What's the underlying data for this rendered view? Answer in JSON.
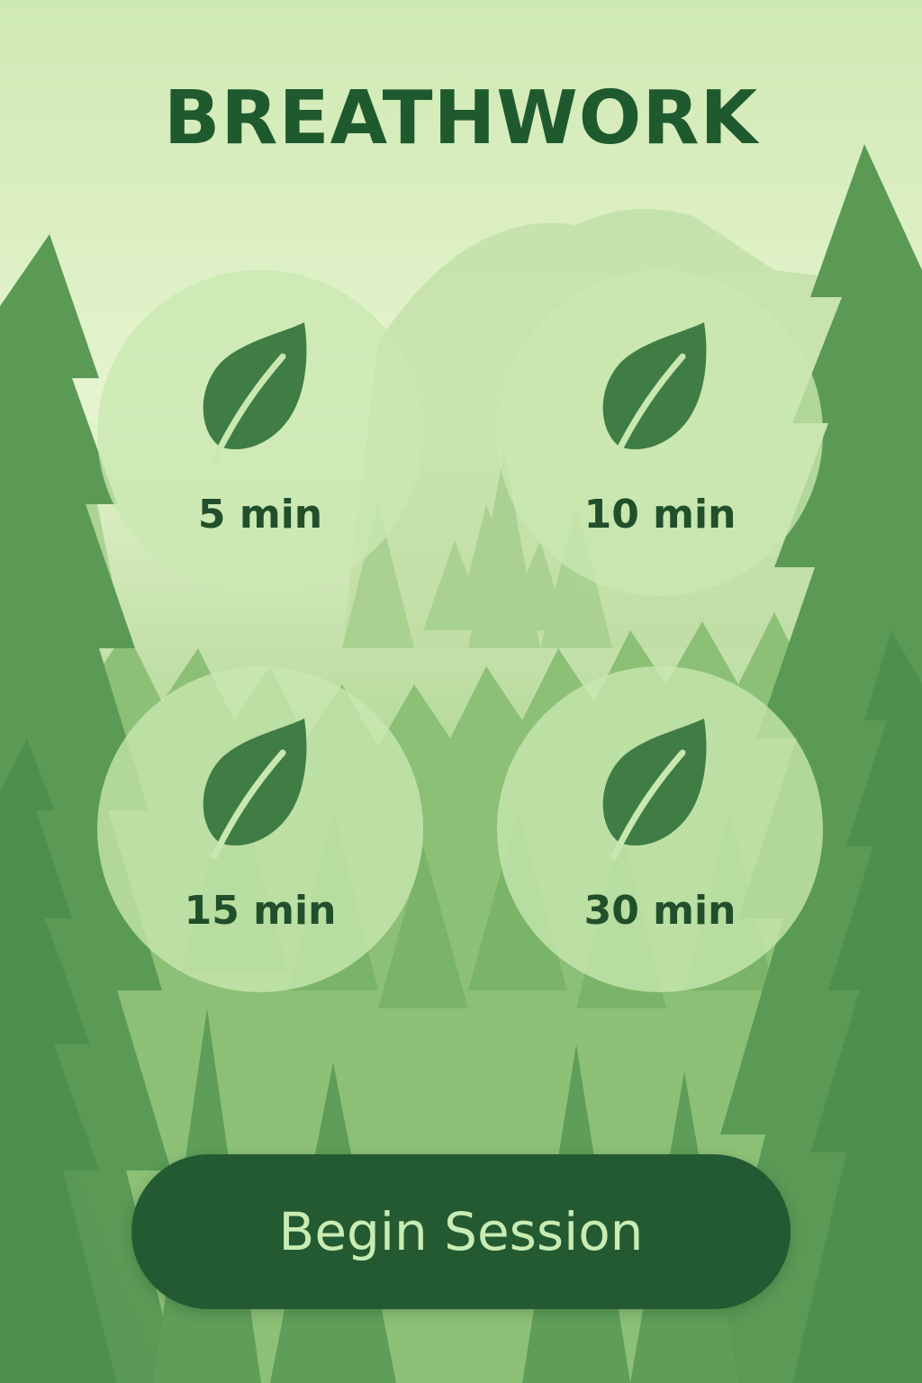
{
  "app": {
    "title": "BREATHWORK"
  },
  "durations": [
    {
      "label": "5 min",
      "icon": "leaf-icon"
    },
    {
      "label": "10 min",
      "icon": "leaf-icon"
    },
    {
      "label": "15 min",
      "icon": "leaf-icon"
    },
    {
      "label": "30 min",
      "icon": "leaf-icon"
    }
  ],
  "actions": {
    "begin_label": "Begin Session"
  },
  "colors": {
    "title": "#1f5a2e",
    "circle": "#c9e8b0",
    "leaf": "#3f7d45",
    "button": "#235a31",
    "button_text": "#c9ecb3"
  }
}
